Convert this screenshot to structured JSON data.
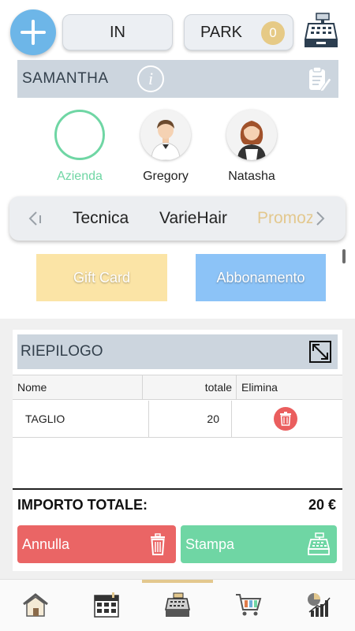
{
  "topbar": {
    "in_label": "IN",
    "park_label": "PARK",
    "park_count": "0"
  },
  "client": {
    "name": "SAMANTHA"
  },
  "staff": [
    {
      "name": "Azienda",
      "active": true
    },
    {
      "name": "Gregory",
      "active": false
    },
    {
      "name": "Natasha",
      "active": false
    }
  ],
  "categories": {
    "items": [
      "Tecnica",
      "VarieHair",
      "Promoz"
    ]
  },
  "cards": {
    "gift": "Gift Card",
    "subscription": "Abbonamento"
  },
  "summary": {
    "title": "RIEPILOGO",
    "columns": {
      "name": "Nome",
      "total": "totale",
      "delete": "Elimina"
    },
    "rows": [
      {
        "name": "TAGLIO",
        "total": "20"
      }
    ],
    "total_label": "IMPORTO TOTALE:",
    "total_value": "20 €",
    "cancel_label": "Annulla",
    "print_label": "Stampa"
  },
  "colors": {
    "accent_blue": "#6db6e8",
    "accent_green": "#6fd6a4",
    "accent_red": "#ea6565",
    "accent_gold": "#e3c88e"
  },
  "tabbar": {
    "icons": [
      "home-icon",
      "calendar-icon",
      "cash-register-icon",
      "cart-icon",
      "stats-icon"
    ],
    "active": 2
  }
}
